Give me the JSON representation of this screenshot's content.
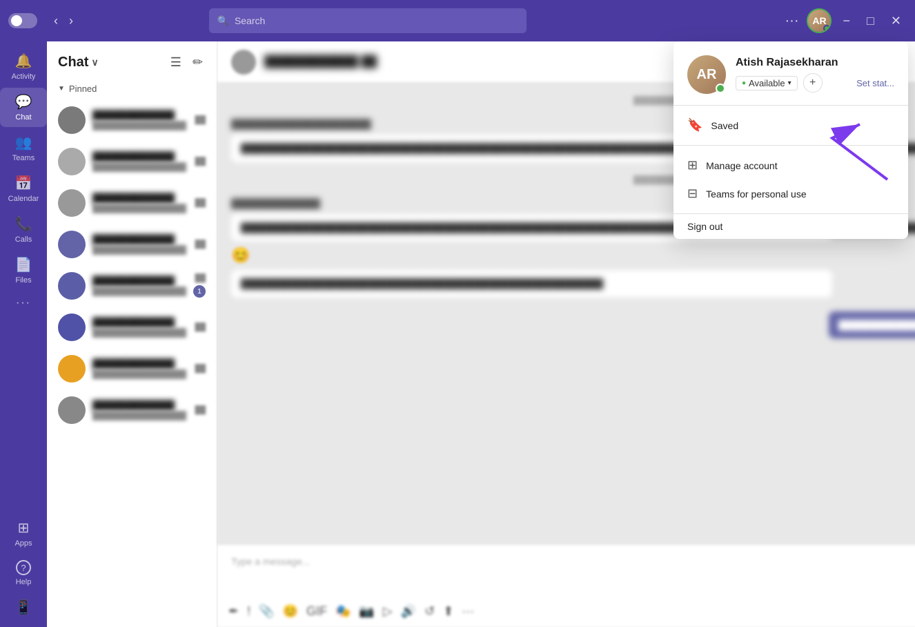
{
  "titlebar": {
    "search_placeholder": "Search",
    "toggle_label": "toggle",
    "minimize_label": "−",
    "maximize_label": "□",
    "close_label": "✕"
  },
  "sidebar": {
    "items": [
      {
        "id": "activity",
        "label": "Activity",
        "icon": "🔔"
      },
      {
        "id": "chat",
        "label": "Chat",
        "icon": "💬",
        "active": true
      },
      {
        "id": "teams",
        "label": "Teams",
        "icon": "👥"
      },
      {
        "id": "calendar",
        "label": "Calendar",
        "icon": "📅"
      },
      {
        "id": "calls",
        "label": "Calls",
        "icon": "📞"
      },
      {
        "id": "files",
        "label": "Files",
        "icon": "📄"
      },
      {
        "id": "more",
        "label": "···",
        "icon": "···"
      },
      {
        "id": "apps",
        "label": "Apps",
        "icon": "⊞"
      },
      {
        "id": "help",
        "label": "Help",
        "icon": "?"
      }
    ]
  },
  "chat_panel": {
    "title": "Chat",
    "pinned_label": "Pinned",
    "items": [
      {
        "id": 1,
        "color": "#888"
      },
      {
        "id": 2,
        "color": "#aaa"
      },
      {
        "id": 3,
        "color": "#999"
      },
      {
        "id": 4,
        "color": "#6264a7"
      },
      {
        "id": 5,
        "color": "#6264a7"
      },
      {
        "id": 6,
        "color": "#6264a7"
      },
      {
        "id": 7,
        "color": "#e8a022"
      },
      {
        "id": 8,
        "color": "#888"
      }
    ]
  },
  "content": {
    "message_placeholder": "Type a message..."
  },
  "profile_dropdown": {
    "username": "Atish Rajasekharan",
    "status": "Available",
    "set_status_label": "Set stat...",
    "saved_label": "Saved",
    "manage_account_label": "Manage account",
    "teams_personal_label": "Teams for personal use",
    "sign_out_label": "Sign out"
  }
}
